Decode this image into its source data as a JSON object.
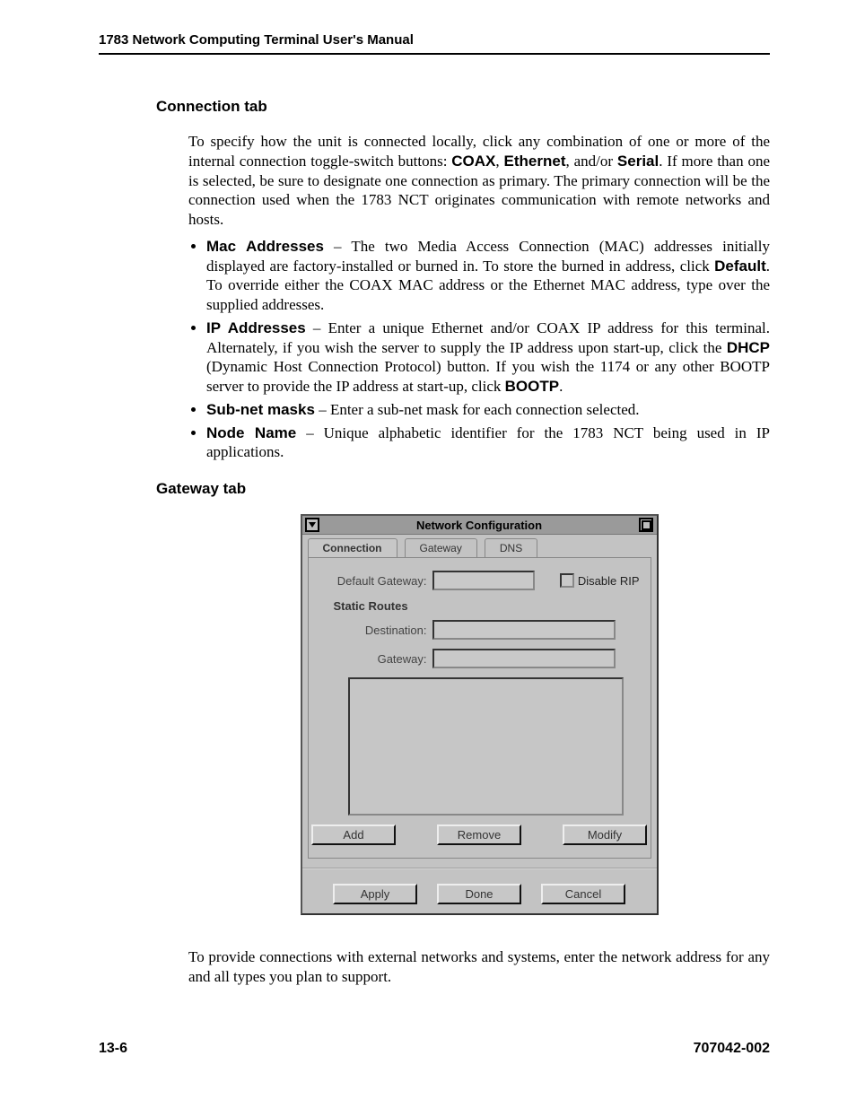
{
  "header": {
    "running": "1783 Network Computing Terminal User's Manual"
  },
  "sections": {
    "connection": {
      "heading": "Connection tab",
      "intro_a": "To specify how the unit is connected locally, click any combination of one or more of the internal connection toggle-switch buttons: ",
      "intro_b": ", and/or ",
      "intro_c": ". If more than one is selected, be sure to designate one connection as primary. The primary connection will be the connection used when the 1783 NCT originates communication with remote networks and hosts.",
      "kw_coax": "COAX",
      "kw_eth": "Ethernet",
      "kw_serial": "Serial",
      "bullets": {
        "mac_label": "Mac Addresses",
        "mac_text_a": " – The two Media Access Connection (MAC) addresses initially displayed are factory-installed or burned in. To store the burned in address, click ",
        "mac_default": "Default",
        "mac_text_b": ". To override either the COAX MAC address or the Ethernet MAC address, type over the supplied addresses.",
        "ip_label": "IP Addresses",
        "ip_text_a": " – Enter a unique Ethernet and/or COAX IP address for this terminal. Alternately, if you wish the server to supply the IP address upon start-up, click the ",
        "ip_dhcp": "DHCP",
        "ip_text_b": " (Dynamic Host Connection Protocol) button. If you wish the 1174 or any other BOOTP server to provide the IP address at start-up, click ",
        "ip_bootp": "BOOTP",
        "ip_text_c": ".",
        "subnet_label": "Sub-net masks",
        "subnet_text": " – Enter a sub-net mask for each connection selected.",
        "node_label": "Node Name",
        "node_text": " – Unique alphabetic identifier for the 1783 NCT being used in IP applications."
      }
    },
    "gateway": {
      "heading": "Gateway tab",
      "closing": "To provide connections with external networks and systems, enter the network address for any and all types you plan to support."
    }
  },
  "dialog": {
    "title": "Network Configuration",
    "tabs": {
      "connection": "Connection",
      "gateway": "Gateway",
      "dns": "DNS"
    },
    "fields": {
      "default_gateway_label": "Default Gateway:",
      "disable_rip": "Disable RIP",
      "static_routes": "Static Routes",
      "destination_label": "Destination:",
      "gateway_label": "Gateway:"
    },
    "buttons": {
      "add": "Add",
      "remove": "Remove",
      "modify": "Modify",
      "apply": "Apply",
      "done": "Done",
      "cancel": "Cancel"
    }
  },
  "footer": {
    "page": "13-6",
    "doc": "707042-002"
  }
}
